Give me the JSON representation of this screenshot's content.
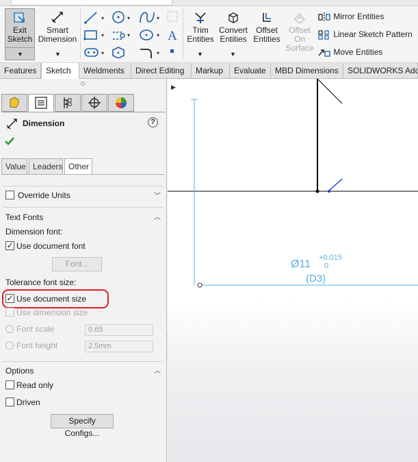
{
  "ribbon": {
    "exit_sketch": "Exit\nSketch",
    "smart_dimension": "Smart\nDimension",
    "trim_entities": "Trim\nEntities",
    "convert_entities": "Convert\nEntities",
    "offset_entities": "Offset\nEntities",
    "offset_on_surface": "Offset\nOn\nSurface",
    "mirror_entities": "Mirror Entities",
    "linear_sketch_pattern": "Linear Sketch Pattern",
    "move_entities": "Move Entities"
  },
  "tabs": [
    "Features",
    "Sketch",
    "Weldments",
    "Direct Editing",
    "Markup",
    "Evaluate",
    "MBD Dimensions",
    "SOLIDWORKS Add-"
  ],
  "active_tab": "Sketch",
  "panel": {
    "title": "Dimension",
    "help": "?",
    "subtabs": [
      "Value",
      "Leaders",
      "Other"
    ],
    "active_subtab": "Other",
    "override_units": {
      "label": "Override Units",
      "checked": false
    },
    "text_fonts": {
      "header": "Text Fonts",
      "dimension_font_label": "Dimension font:",
      "use_document_font": {
        "label": "Use document font",
        "checked": true
      },
      "font_button": "Font...",
      "tolerance_font_size_label": "Tolerance font size:",
      "use_document_size": {
        "label": "Use document size",
        "checked": true
      },
      "use_dimension_size": {
        "label": "Use dimension size",
        "checked": false
      },
      "font_scale": {
        "label": "Font scale",
        "value": "0.65"
      },
      "font_height": {
        "label": "Font height",
        "value": "2.5mm"
      }
    },
    "options": {
      "header": "Options",
      "read_only": {
        "label": "Read only",
        "checked": false
      },
      "driven": {
        "label": "Driven",
        "checked": false
      },
      "specify_configs": "Specify Configs..."
    }
  },
  "canvas": {
    "dimension_symbol": "Ø",
    "dimension_value": "11",
    "tolerance_upper": "+0.015",
    "tolerance_lower": "0",
    "dimension_name": "(D3)"
  },
  "colors": {
    "dimension": "#55b0e0",
    "sketch_line": "#000000",
    "highlight": "#e0201e",
    "check": "#2e9a2e"
  }
}
